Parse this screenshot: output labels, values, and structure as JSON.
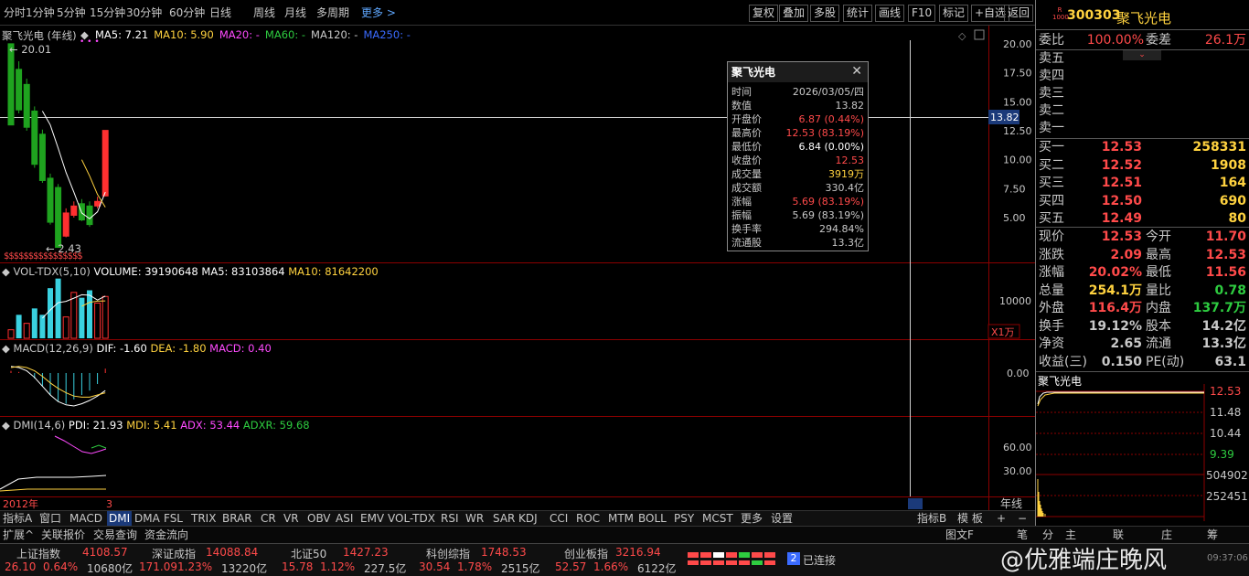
{
  "toolbar": {
    "periods": [
      "分时",
      "1分钟",
      "5分钟",
      "15分钟",
      "30分钟",
      "60分钟",
      "日线",
      "周线",
      "月线",
      "多周期"
    ],
    "active_period": "年线",
    "more": "更多 >",
    "right_buttons": [
      "复权",
      "叠加",
      "多股",
      "统计",
      "画线",
      "F10",
      "标记",
      "+自选",
      "返回"
    ]
  },
  "stock_header": {
    "badge": "R\n1000",
    "code": "300303",
    "name": "聚飞光电"
  },
  "main_chart": {
    "title": "聚飞光电 (年线)",
    "ma_labels": [
      {
        "text": "MA5: 7.21",
        "color": "#ffffff"
      },
      {
        "text": "MA10: 5.90",
        "color": "#ffd23f"
      },
      {
        "text": "MA20: -",
        "color": "#ff4aff"
      },
      {
        "text": "MA60: -",
        "color": "#2ecc40"
      },
      {
        "text": "MA120: -",
        "color": "#c8c8c8"
      },
      {
        "text": "MA250: -",
        "color": "#3a6bff"
      }
    ],
    "high_label": "20.01",
    "low_label": "2.43",
    "y_ticks": [
      "20.00",
      "17.50",
      "15.00",
      "12.50",
      "10.00",
      "7.50",
      "5.00"
    ],
    "crosshair_value": "13.82",
    "s_marks": "$$$$$$$$$$$$$$$$"
  },
  "volume": {
    "title": "VOL-TDX(5,10)",
    "volume": "VOLUME: 39190648",
    "ma5": "MA5: 83103864",
    "ma10": "MA10: 81642200",
    "tick": "10000",
    "unit": "X1万"
  },
  "macd": {
    "title": "MACD(12,26,9)",
    "dif": "DIF: -1.60",
    "dea": "DEA: -1.80",
    "macd": "MACD: 0.40",
    "tick": "0.00"
  },
  "dmi": {
    "title": "DMI(14,6)",
    "pdi": "PDI: 21.93",
    "mdi": "MDI: 5.41",
    "adx": "ADX: 53.44",
    "adxr": "ADXR: 59.68",
    "ticks": [
      "60.00",
      "30.00"
    ]
  },
  "x_axis": {
    "start": "2012年",
    "mark": "3",
    "period_label": "年线"
  },
  "tooltip": {
    "title": "聚飞光电",
    "rows": [
      {
        "k": "时间",
        "v": "2026/03/05/四",
        "c": "#c8c8c8"
      },
      {
        "k": "数值",
        "v": "13.82",
        "c": "#c8c8c8"
      },
      {
        "k": "开盘价",
        "v": "6.87 (0.44%)",
        "c": "#ff4a4a"
      },
      {
        "k": "最高价",
        "v": "12.53 (83.19%)",
        "c": "#ff4a4a"
      },
      {
        "k": "最低价",
        "v": "6.84 (0.00%)",
        "c": "#ffffff"
      },
      {
        "k": "收盘价",
        "v": "12.53",
        "c": "#ff4a4a"
      },
      {
        "k": "成交量",
        "v": "3919万",
        "c": "#ffd23f"
      },
      {
        "k": "成交额",
        "v": "330.4亿",
        "c": "#c8c8c8"
      },
      {
        "k": "涨幅",
        "v": "5.69 (83.19%)",
        "c": "#ff4a4a"
      },
      {
        "k": "振幅",
        "v": "5.69 (83.19%)",
        "c": "#c8c8c8"
      },
      {
        "k": "换手率",
        "v": "294.84%",
        "c": "#c8c8c8"
      },
      {
        "k": "流通股",
        "v": "13.3亿",
        "c": "#c8c8c8"
      }
    ]
  },
  "quote": {
    "weibi_label": "委比",
    "weibi": "100.00%",
    "weicha_label": "委差",
    "weicha": "26.1万",
    "sells": [
      {
        "k": "卖五"
      },
      {
        "k": "卖四"
      },
      {
        "k": "卖三"
      },
      {
        "k": "卖二"
      },
      {
        "k": "卖一"
      }
    ],
    "buys": [
      {
        "k": "买一",
        "p": "12.53",
        "v": "258331"
      },
      {
        "k": "买二",
        "p": "12.52",
        "v": "1908"
      },
      {
        "k": "买三",
        "p": "12.51",
        "v": "164"
      },
      {
        "k": "买四",
        "p": "12.50",
        "v": "690"
      },
      {
        "k": "买五",
        "p": "12.49",
        "v": "80"
      }
    ],
    "stats": [
      {
        "k1": "现价",
        "v1": "12.53",
        "c1": "#ff4a4a",
        "k2": "今开",
        "v2": "11.70",
        "c2": "#ff4a4a"
      },
      {
        "k1": "涨跌",
        "v1": "2.09",
        "c1": "#ff4a4a",
        "k2": "最高",
        "v2": "12.53",
        "c2": "#ff4a4a"
      },
      {
        "k1": "涨幅",
        "v1": "20.02%",
        "c1": "#ff4a4a",
        "k2": "最低",
        "v2": "11.56",
        "c2": "#ff4a4a"
      },
      {
        "k1": "总量",
        "v1": "254.1万",
        "c1": "#ffd23f",
        "k2": "量比",
        "v2": "0.78",
        "c2": "#2ecc40"
      },
      {
        "k1": "外盘",
        "v1": "116.4万",
        "c1": "#ff4a4a",
        "k2": "内盘",
        "v2": "137.7万",
        "c2": "#2ecc40"
      },
      {
        "k1": "换手",
        "v1": "19.12%",
        "c1": "#c8c8c8",
        "k2": "股本",
        "v2": "14.2亿",
        "c2": "#c8c8c8"
      },
      {
        "k1": "净资",
        "v1": "2.65",
        "c1": "#c8c8c8",
        "k2": "流通",
        "v2": "13.3亿",
        "c2": "#c8c8c8"
      },
      {
        "k1": "收益(三)",
        "v1": "0.150",
        "c1": "#c8c8c8",
        "k2": "PE(动)",
        "v2": "63.1",
        "c2": "#c8c8c8"
      }
    ],
    "mini_title": "聚飞光电",
    "mini_prices": [
      "12.53",
      "11.48",
      "10.44",
      "9.39"
    ],
    "mini_vols": [
      "504902",
      "252451"
    ]
  },
  "bottom_tabs": [
    "指标A",
    "窗口",
    "MACD",
    "DMI",
    "DMA",
    "FSL",
    "TRIX",
    "BRAR",
    "CR",
    "VR",
    "OBV",
    "ASI",
    "EMV",
    "VOL-TDX",
    "RSI",
    "WR",
    "SAR",
    "KDJ",
    "CCI",
    "ROC",
    "MTM",
    "BOLL",
    "PSY",
    "MCST",
    "更多",
    "设置"
  ],
  "bottom_right_tabs": [
    "指标B",
    "模 板",
    "+",
    "−"
  ],
  "ext_tabs": [
    "扩展^",
    "关联报价",
    "交易查询",
    "资金流向"
  ],
  "ext_right": [
    "图文F",
    "笔",
    "分",
    "主",
    "联",
    "庄",
    "筹"
  ],
  "indices": [
    {
      "name": "上证指数",
      "val": "4108.57",
      "chg": "26.10",
      "pct": "0.64%",
      "amt": "10680亿"
    },
    {
      "name": "深证成指",
      "val": "14088.84",
      "chg": "171.09",
      "pct": "1.23%",
      "amt": "13220亿"
    },
    {
      "name": "北证50",
      "val": "1427.23",
      "chg": "15.78",
      "pct": "1.12%",
      "amt": "227.5亿"
    },
    {
      "name": "科创综指",
      "val": "1748.53",
      "chg": "30.54",
      "pct": "1.78%",
      "amt": "2515亿"
    },
    {
      "name": "创业板指",
      "val": "3216.94",
      "chg": "52.57",
      "pct": "1.66%",
      "amt": "6122亿"
    }
  ],
  "connection": {
    "count": "2",
    "text": "已连接"
  },
  "watermark": "@优雅端庄晚风",
  "time": "09:37:06",
  "chart_data": {
    "type": "candlestick",
    "candles": [
      {
        "o": 20.01,
        "h": 20.01,
        "c": 13.0,
        "l": 13.0
      },
      {
        "o": 17.8,
        "h": 18.5,
        "c": 14.3,
        "l": 14.0
      },
      {
        "o": 16.5,
        "h": 17.0,
        "c": 12.8,
        "l": 12.5
      },
      {
        "o": 14.2,
        "h": 14.6,
        "c": 9.6,
        "l": 9.3
      },
      {
        "o": 12.2,
        "h": 12.6,
        "c": 8.2,
        "l": 8.0
      },
      {
        "o": 8.4,
        "h": 8.8,
        "c": 4.6,
        "l": 4.4
      },
      {
        "o": 7.6,
        "h": 7.9,
        "c": 2.43,
        "l": 2.43
      },
      {
        "o": 3.4,
        "h": 5.8,
        "c": 5.4,
        "l": 3.3
      },
      {
        "o": 5.2,
        "h": 6.4,
        "c": 6.0,
        "l": 5.0
      },
      {
        "o": 6.2,
        "h": 6.6,
        "c": 4.8,
        "l": 4.7
      },
      {
        "o": 6.0,
        "h": 6.4,
        "c": 4.4,
        "l": 4.2
      },
      {
        "o": 6.0,
        "h": 6.8,
        "c": 6.4,
        "l": 5.8
      },
      {
        "o": 6.87,
        "h": 12.53,
        "c": 12.53,
        "l": 6.84
      }
    ],
    "ma5": [
      null,
      null,
      null,
      null,
      14.2,
      13.0,
      11.0,
      8.9,
      7.2,
      5.4,
      4.9,
      5.5,
      7.21
    ],
    "ma10": [
      null,
      null,
      null,
      null,
      null,
      null,
      null,
      null,
      null,
      10.0,
      8.6,
      7.0,
      5.9
    ],
    "volume": [
      800,
      2200,
      1400,
      2800,
      2200,
      4700,
      5600,
      2000,
      4300,
      3800,
      4500,
      3300,
      3919
    ],
    "vol_up": [
      true,
      false,
      true,
      false,
      false,
      false,
      false,
      true,
      true,
      false,
      false,
      true,
      true
    ],
    "macd_hist": [
      0.2,
      0.1,
      0.0,
      -0.5,
      -1.2,
      -2.0,
      -2.6,
      -2.8,
      -2.4,
      -2.0,
      -1.6,
      -1.0,
      0.4
    ],
    "dif": [
      0.6,
      0.5,
      0.2,
      -0.4,
      -1.2,
      -2.0,
      -2.6,
      -2.9,
      -3.0,
      -2.8,
      -2.5,
      -2.1,
      -1.6
    ],
    "dea": [
      0.5,
      0.6,
      0.5,
      0.2,
      -0.3,
      -0.9,
      -1.4,
      -1.8,
      -2.1,
      -2.2,
      -2.2,
      -2.0,
      -1.8
    ],
    "y_range": [
      0,
      21
    ]
  }
}
